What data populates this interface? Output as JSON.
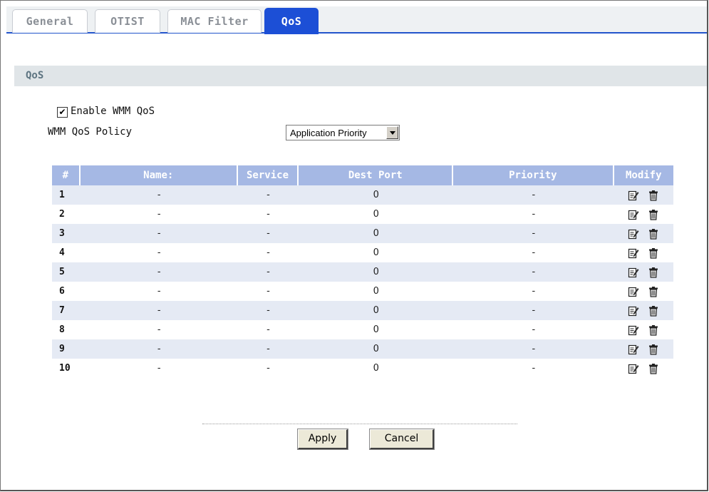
{
  "tabs": [
    {
      "label": "General",
      "active": false
    },
    {
      "label": "OTIST",
      "active": false
    },
    {
      "label": "MAC Filter",
      "active": false
    },
    {
      "label": "QoS",
      "active": true
    }
  ],
  "section": {
    "title": "QoS"
  },
  "wmm": {
    "enable_label": "Enable WMM QoS",
    "enabled": true,
    "policy_label": "WMM QoS Policy",
    "policy_value": "Application Priority"
  },
  "table": {
    "headers": [
      "#",
      "Name:",
      "Service",
      "Dest Port",
      "Priority",
      "Modify"
    ],
    "rows": [
      {
        "num": "1",
        "name": "-",
        "service": "-",
        "port": "0",
        "priority": "-"
      },
      {
        "num": "2",
        "name": "-",
        "service": "-",
        "port": "0",
        "priority": "-"
      },
      {
        "num": "3",
        "name": "-",
        "service": "-",
        "port": "0",
        "priority": "-"
      },
      {
        "num": "4",
        "name": "-",
        "service": "-",
        "port": "0",
        "priority": "-"
      },
      {
        "num": "5",
        "name": "-",
        "service": "-",
        "port": "0",
        "priority": "-"
      },
      {
        "num": "6",
        "name": "-",
        "service": "-",
        "port": "0",
        "priority": "-"
      },
      {
        "num": "7",
        "name": "-",
        "service": "-",
        "port": "0",
        "priority": "-"
      },
      {
        "num": "8",
        "name": "-",
        "service": "-",
        "port": "0",
        "priority": "-"
      },
      {
        "num": "9",
        "name": "-",
        "service": "-",
        "port": "0",
        "priority": "-"
      },
      {
        "num": "10",
        "name": "-",
        "service": "-",
        "port": "0",
        "priority": "-"
      }
    ],
    "modify_icons": [
      "edit-icon",
      "delete-icon"
    ]
  },
  "buttons": {
    "apply": "Apply",
    "cancel": "Cancel"
  }
}
